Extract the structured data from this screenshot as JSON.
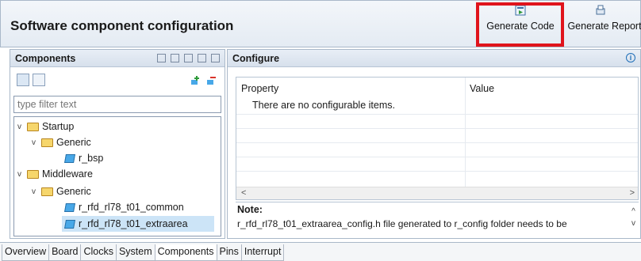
{
  "header": {
    "title": "Software component configuration",
    "generate_code": "Generate Code",
    "generate_report": "Generate Report"
  },
  "components_panel": {
    "title": "Components",
    "filter_placeholder": "type filter text",
    "tree": [
      {
        "label": "Startup",
        "level": 0,
        "kind": "folder"
      },
      {
        "label": "Generic",
        "level": 1,
        "kind": "folder"
      },
      {
        "label": "r_bsp",
        "level": 2,
        "kind": "component"
      },
      {
        "label": "Middleware",
        "level": 0,
        "kind": "folder"
      },
      {
        "label": "Generic",
        "level": 1,
        "kind": "folder"
      },
      {
        "label": "r_rfd_rl78_t01_common",
        "level": 2,
        "kind": "component"
      },
      {
        "label": "r_rfd_rl78_t01_extraarea",
        "level": 2,
        "kind": "component",
        "selected": true
      }
    ]
  },
  "configure_panel": {
    "title": "Configure",
    "col_property": "Property",
    "col_value": "Value",
    "empty_message": "There are no configurable items.",
    "note_title": "Note:",
    "note_text": "r_rfd_rl78_t01_extraarea_config.h file generated to r_config folder needs to be"
  },
  "tabs": [
    "Overview",
    "Board",
    "Clocks",
    "System",
    "Components",
    "Pins",
    "Interrupt"
  ],
  "active_tab": "Components",
  "colors": {
    "highlight": "#e0141c",
    "selection": "#cce4f7"
  }
}
